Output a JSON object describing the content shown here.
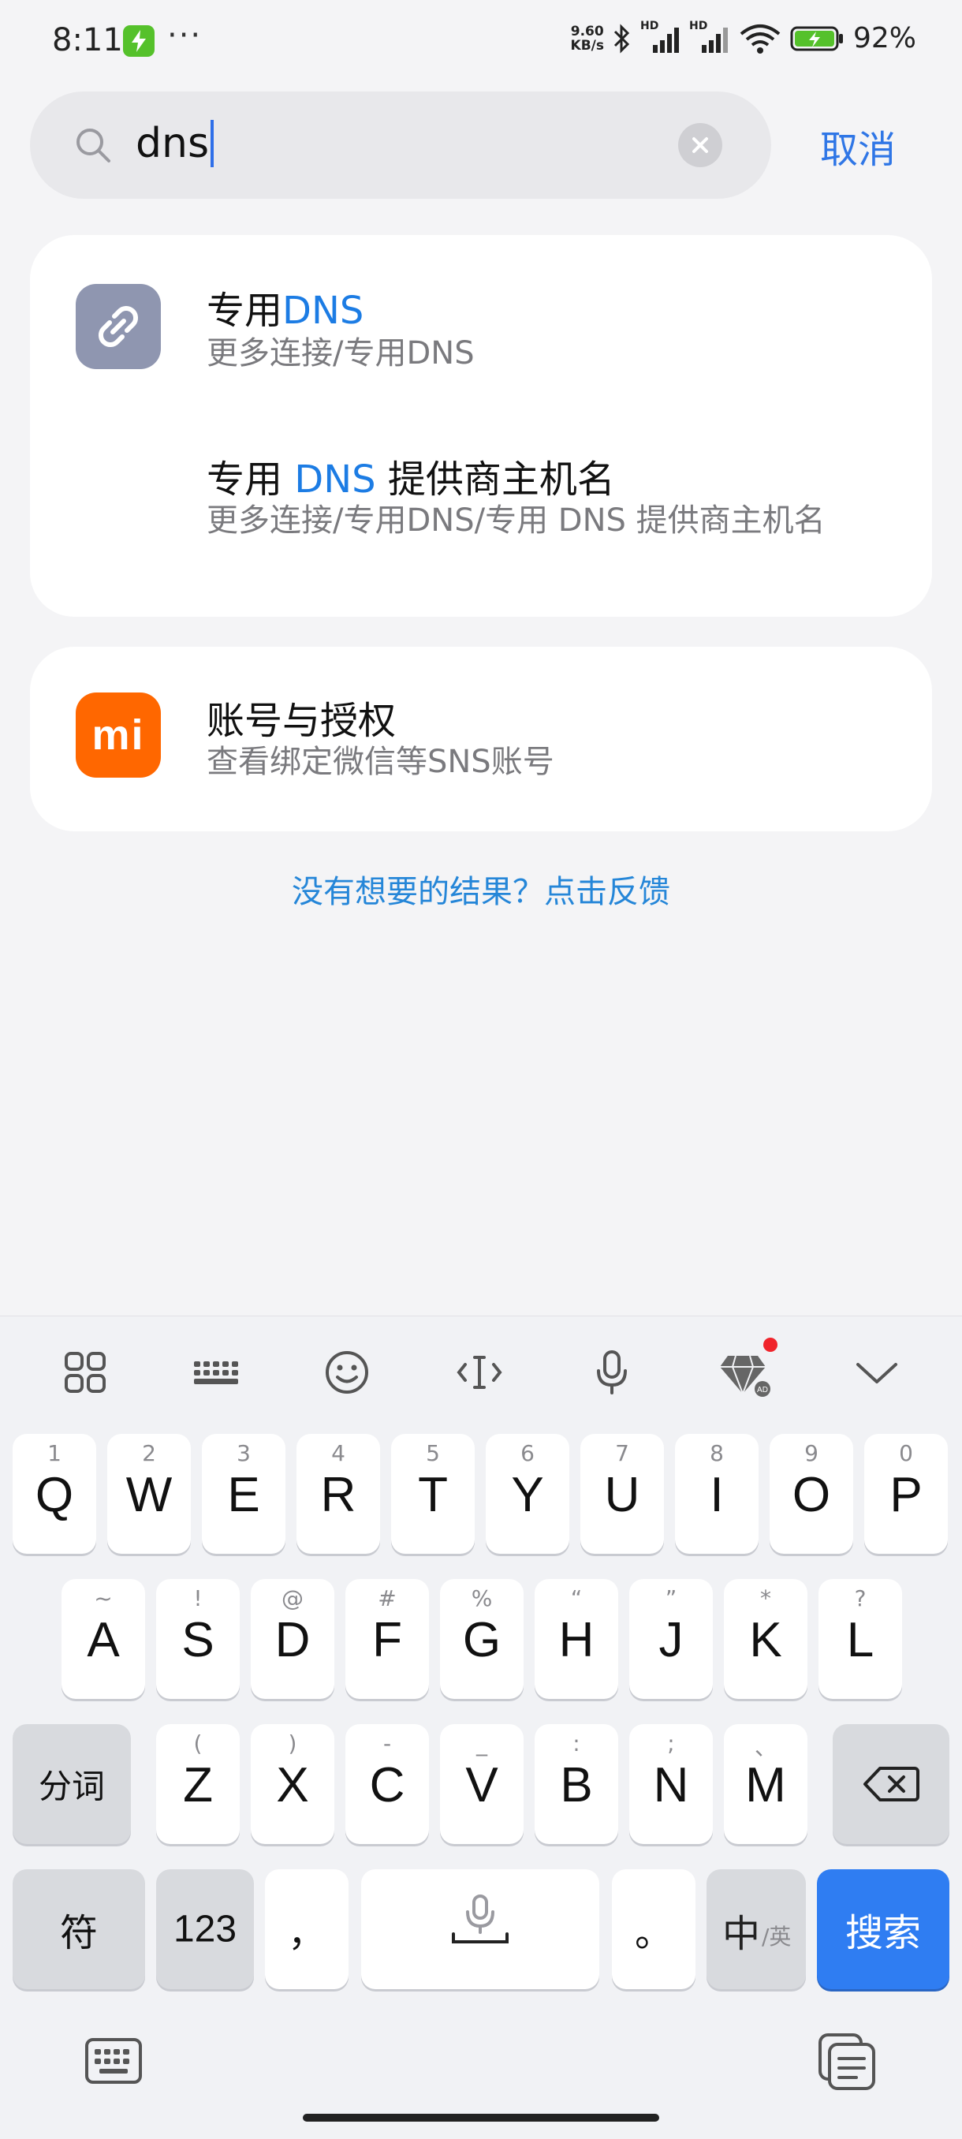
{
  "status_bar": {
    "time": "8:11",
    "more": "···",
    "net_speed_value": "9.60",
    "net_speed_unit": "KB/s",
    "signal1_label": "HD",
    "signal2_label": "HD",
    "battery_percent": "92%"
  },
  "search": {
    "query": "dns",
    "cancel_label": "取消"
  },
  "results": {
    "group1": {
      "item1": {
        "title_prefix": "专用",
        "title_highlight": "DNS",
        "subtitle": "更多连接/专用DNS",
        "icon": "link-icon"
      },
      "item2": {
        "title_prefix": "专用 ",
        "title_highlight": "DNS",
        "title_suffix": " 提供商主机名",
        "subtitle": "更多连接/专用DNS/专用 DNS 提供商主机名"
      }
    },
    "group2": {
      "item1": {
        "title": "账号与授权",
        "subtitle": "查看绑定微信等SNS账号",
        "icon": "mi-logo-icon",
        "icon_text": "mi"
      }
    }
  },
  "feedback_link": "没有想要的结果？点击反馈",
  "keyboard": {
    "toolbar": [
      "apps-grid-icon",
      "keyboard-layout-icon",
      "emoji-icon",
      "text-cursor-icon",
      "microphone-icon",
      "diamond-skin-icon",
      "collapse-keyboard-icon"
    ],
    "diamond_badge": "AD",
    "row1": [
      {
        "main": "Q",
        "hint": "1"
      },
      {
        "main": "W",
        "hint": "2"
      },
      {
        "main": "E",
        "hint": "3"
      },
      {
        "main": "R",
        "hint": "4"
      },
      {
        "main": "T",
        "hint": "5"
      },
      {
        "main": "Y",
        "hint": "6"
      },
      {
        "main": "U",
        "hint": "7"
      },
      {
        "main": "I",
        "hint": "8"
      },
      {
        "main": "O",
        "hint": "9"
      },
      {
        "main": "P",
        "hint": "0"
      }
    ],
    "row2": [
      {
        "main": "A",
        "hint": "~"
      },
      {
        "main": "S",
        "hint": "!"
      },
      {
        "main": "D",
        "hint": "@"
      },
      {
        "main": "F",
        "hint": "#"
      },
      {
        "main": "G",
        "hint": "%"
      },
      {
        "main": "H",
        "hint": "“"
      },
      {
        "main": "J",
        "hint": "”"
      },
      {
        "main": "K",
        "hint": "*"
      },
      {
        "main": "L",
        "hint": "?"
      }
    ],
    "row3": [
      {
        "main": "Z",
        "hint": "("
      },
      {
        "main": "X",
        "hint": ")"
      },
      {
        "main": "C",
        "hint": "-"
      },
      {
        "main": "V",
        "hint": "_"
      },
      {
        "main": "B",
        "hint": ":"
      },
      {
        "main": "N",
        "hint": ";"
      },
      {
        "main": "M",
        "hint": "、"
      }
    ],
    "segment_label": "分词",
    "symbol_label": "符",
    "numbers_label": "123",
    "comma_label": "，",
    "period_label": "。",
    "lang_main": "中",
    "lang_sub": "/英",
    "search_label": "搜索"
  },
  "colors": {
    "accent": "#2f76e6",
    "highlight": "#1c7ce4",
    "mi_orange": "#ff6700",
    "search_key": "#2f7df2"
  }
}
